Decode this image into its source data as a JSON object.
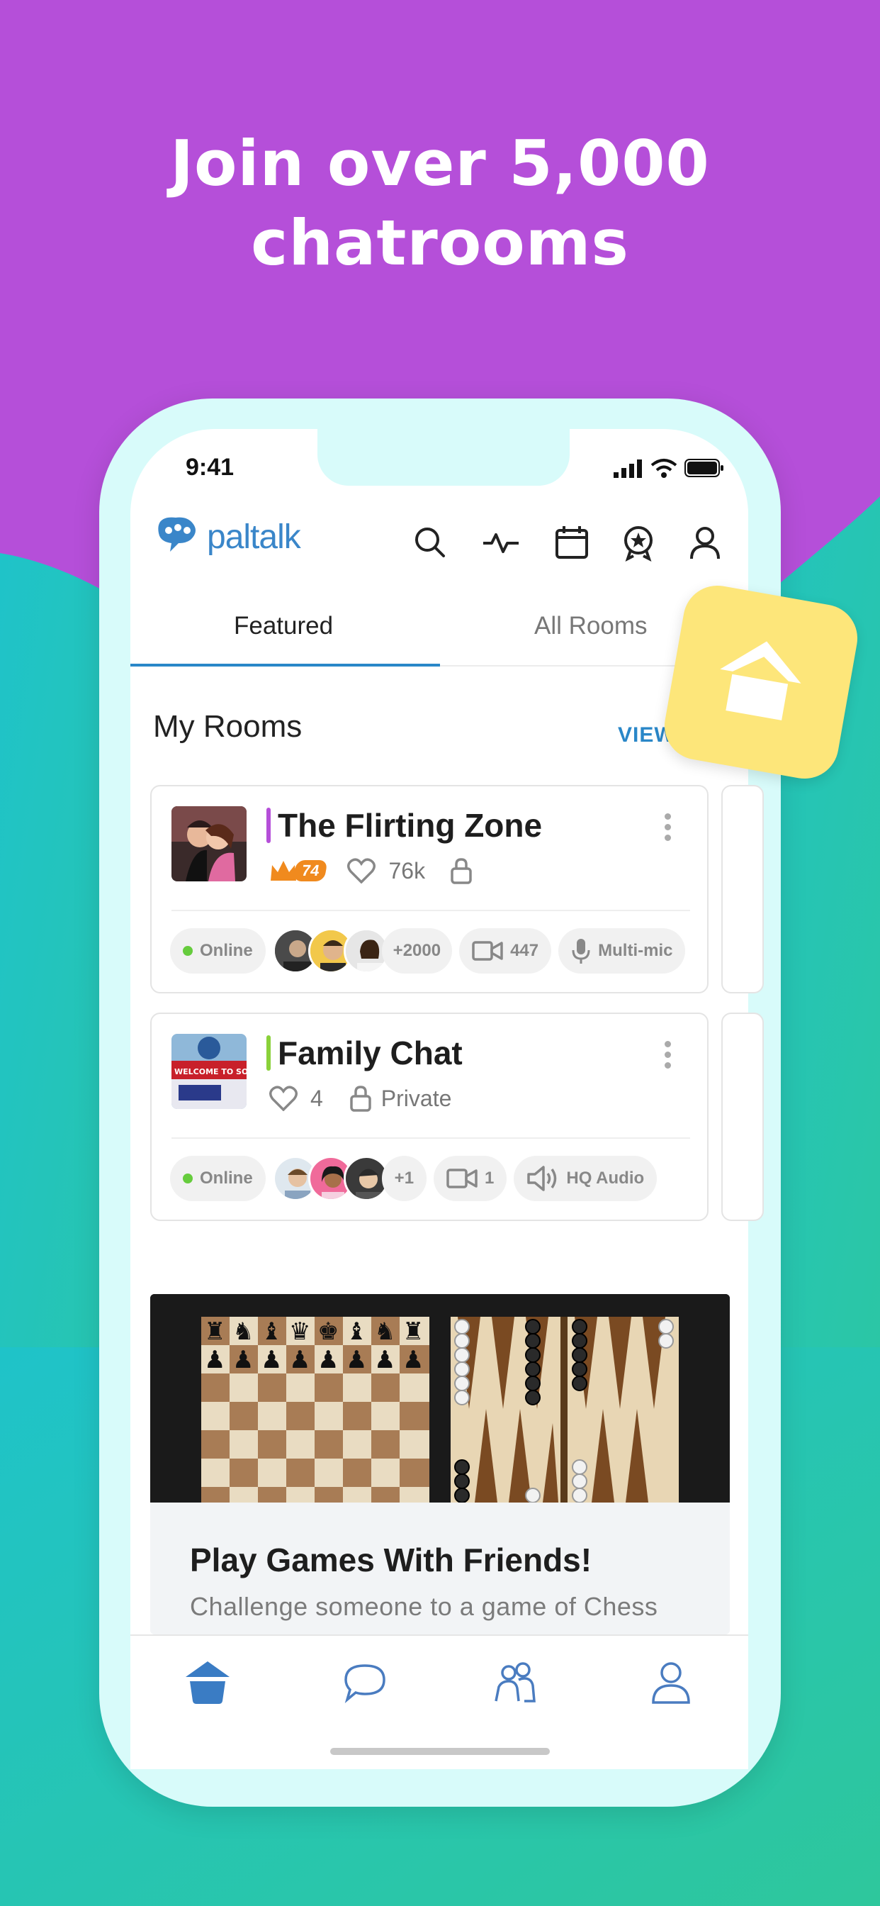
{
  "headline": {
    "line1": "Join over 5,000",
    "line2": "chatrooms"
  },
  "status_bar": {
    "time": "9:41"
  },
  "app": {
    "logo_text": "paltalk",
    "header_icons": [
      "search-icon",
      "activity-icon",
      "calendar-icon",
      "badge-icon",
      "profile-icon"
    ]
  },
  "tabs": [
    {
      "label": "Featured",
      "active": true
    },
    {
      "label": "All Rooms",
      "active": false
    }
  ],
  "my_rooms": {
    "title": "My Rooms",
    "view_all": "VIEW A"
  },
  "rooms": [
    {
      "name": "The Flirting Zone",
      "accent": "#b54fd9",
      "crown_level": "74",
      "likes": "76k",
      "status": "Online",
      "more_users": "+2000",
      "video_count": "447",
      "audio_label": "Multi-mic"
    },
    {
      "name": "Family Chat",
      "accent": "#8ad13a",
      "thumb_sign": "WELCOME TO SOLLEY'S FA",
      "likes": "4",
      "privacy": "Private",
      "status": "Online",
      "more_users": "+1",
      "video_count": "1",
      "audio_label": "HQ Audio"
    }
  ],
  "games_banner": {
    "title": "Play Games With Friends!",
    "description": "Challenge someone to a game of Chess"
  },
  "bottom_nav": [
    "home-icon",
    "chat-icon",
    "friends-icon",
    "profile-icon"
  ],
  "colors": {
    "brand": "#2a87c8",
    "purple": "#b54fd9",
    "teal": "#22c4c4",
    "fab": "#fde67a"
  }
}
